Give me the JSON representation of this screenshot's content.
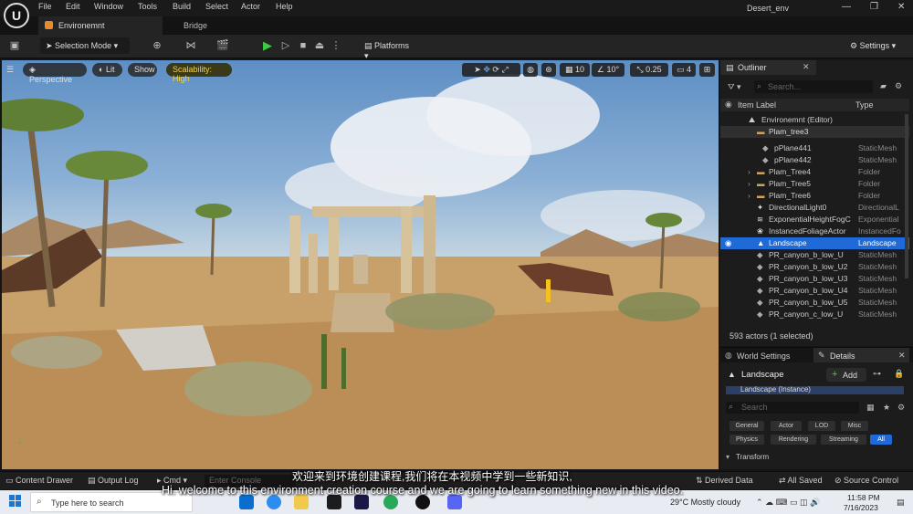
{
  "titlebar": {
    "menu": [
      "File",
      "Edit",
      "Window",
      "Tools",
      "Build",
      "Select",
      "Actor",
      "Help"
    ],
    "project": "Desert_env"
  },
  "tabs": {
    "level_tab": "Environemnt",
    "bridge_tab": "Bridge"
  },
  "toolbar": {
    "selection_mode": "Selection Mode",
    "platforms": "Platforms",
    "settings": "Settings"
  },
  "viewport": {
    "perspective": "Perspective",
    "lit": "Lit",
    "show": "Show",
    "scalability": "Scalability: High",
    "grid_snap": "10",
    "rotation_snap": "10°",
    "scale_snap": "0.25",
    "camera_speed": "4"
  },
  "outliner": {
    "title": "Outliner",
    "search_placeholder": "Search...",
    "col_label": "Item Label",
    "col_type": "Type",
    "rows": [
      {
        "name": "Environemnt (Editor)",
        "type": ""
      },
      {
        "name": "Plam_tree3",
        "type": ""
      },
      {
        "name": "pPlane441",
        "type": "StaticMesh"
      },
      {
        "name": "pPlane442",
        "type": "StaticMesh"
      },
      {
        "name": "Plam_Tree4",
        "type": "Folder"
      },
      {
        "name": "Plam_Tree5",
        "type": "Folder"
      },
      {
        "name": "Plam_Tree6",
        "type": "Folder"
      },
      {
        "name": "DirectionalLight0",
        "type": "DirectionalL"
      },
      {
        "name": "ExponentialHeightFogC",
        "type": "Exponential"
      },
      {
        "name": "InstancedFoliageActor",
        "type": "InstancedFo"
      },
      {
        "name": "Landscape",
        "type": "Landscape"
      },
      {
        "name": "PR_canyon_b_low_U",
        "type": "StaticMesh"
      },
      {
        "name": "PR_canyon_b_low_U2",
        "type": "StaticMesh"
      },
      {
        "name": "PR_canyon_b_low_U3",
        "type": "StaticMesh"
      },
      {
        "name": "PR_canyon_b_low_U4",
        "type": "StaticMesh"
      },
      {
        "name": "PR_canyon_b_low_U5",
        "type": "StaticMesh"
      },
      {
        "name": "PR_canyon_c_low_U",
        "type": "StaticMesh"
      }
    ],
    "status": "593 actors (1 selected)"
  },
  "details": {
    "world_settings_tab": "World Settings",
    "details_tab": "Details",
    "actor_name": "Landscape",
    "add_button": "Add",
    "component": "Landscape (Instance)",
    "search_placeholder": "Search",
    "filters_row1": [
      "General",
      "Actor",
      "LOD",
      "Misc"
    ],
    "filters_row2": [
      "Physics",
      "Rendering",
      "Streaming",
      "All"
    ],
    "section": "Transform"
  },
  "bottombar": {
    "content_drawer": "Content Drawer",
    "output_log": "Output Log",
    "cmd": "Cmd",
    "console_placeholder": "Enter Console Command",
    "derived_data": "Derived Data",
    "all_saved": "All Saved",
    "source_control": "Source Control"
  },
  "taskbar": {
    "search_placeholder": "Type here to search",
    "weather": "29°C  Mostly cloudy",
    "time": "11:58 PM",
    "date": "7/16/2023"
  },
  "subtitles": {
    "zh": "欢迎来到环境创建课程,我们将在本视频中学到一些新知识,",
    "en": "Hi. welcome to this environment creation course and we are going to learn something new in this video."
  }
}
